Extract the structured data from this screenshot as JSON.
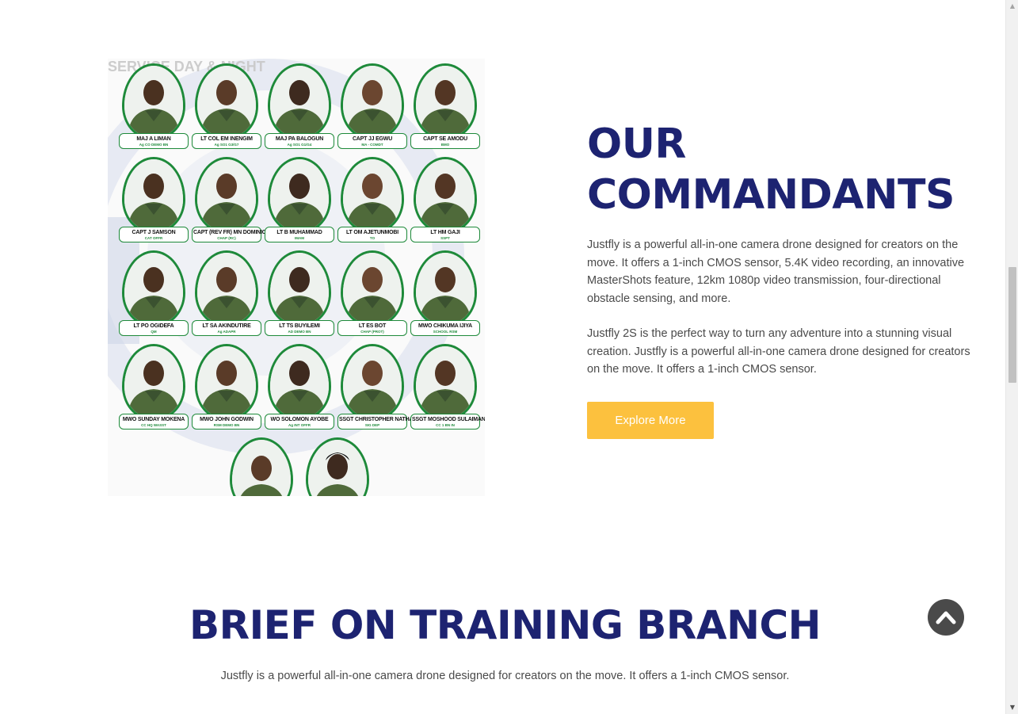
{
  "commandants": {
    "title_line1": "OUR",
    "title_line2": "COMMANDANTS",
    "para1": "Justfly is a powerful all-in-one camera drone designed for creators on the move. It offers a 1-inch CMOS sensor, 5.4K video recording, an innovative MasterShots feature, 12km 1080p video transmission, four-directional obstacle sensing, and more.",
    "para2": "Justfly 2S is the perfect way to turn any adventure into a stunning visual creation. Justfly is a powerful all-in-one camera drone designed for creators on the move. It offers a 1-inch CMOS sensor.",
    "button_label": "Explore More",
    "image": {
      "banner_text": "SERVICE DAY & NIGHT",
      "officers": [
        {
          "name": "MAJ A LIMAN",
          "role": "Ag CO DEMO BN"
        },
        {
          "name": "LT COL EM INENGIM",
          "role": "Ag SO1 G3/G7"
        },
        {
          "name": "MAJ PA BALOGUN",
          "role": "Ag SO1 G1/G4"
        },
        {
          "name": "CAPT JJ EGWU",
          "role": "MA - COMDT"
        },
        {
          "name": "CAPT SE AMODU",
          "role": "BMO"
        },
        {
          "name": "CAPT J SAMSON",
          "role": "CAT OFFR"
        },
        {
          "name": "CAPT (REV FR) MN DOMINIC",
          "role": "CHAP (RC)"
        },
        {
          "name": "LT B MUHAMMAD",
          "role": "IMAM"
        },
        {
          "name": "LT OM AJETUNMOBI",
          "role": "TO"
        },
        {
          "name": "LT HM GAJI",
          "role": "SSPT"
        },
        {
          "name": "LT PO OGIDEFA",
          "role": "QM"
        },
        {
          "name": "LT SA AKINDUTIRE",
          "role": "Ag ADAPR"
        },
        {
          "name": "LT TS BUYILEMI",
          "role": "AD DEMO BN"
        },
        {
          "name": "LT ES BOT",
          "role": "CHAP (PROT)"
        },
        {
          "name": "MWO CHIKUMA IJIYA",
          "role": "SCHOOL RSM"
        },
        {
          "name": "MWO SUNDAY MOKENA",
          "role": "CC HQ WASST"
        },
        {
          "name": "MWO JOHN GODWIN",
          "role": "RSM DEMO BN"
        },
        {
          "name": "WO SOLOMON AYOBE",
          "role": "Ag INT OFFR"
        },
        {
          "name": "SSGT CHRISTOPHER NATHANIEL",
          "role": "SIG DEP"
        },
        {
          "name": "SSGT MOSHOOD SULAIMAN",
          "role": "CC 1 BN IN"
        }
      ]
    }
  },
  "brief": {
    "title": "BRIEF ON TRAINING BRANCH",
    "para": "Justfly is a powerful all-in-one camera drone designed for creators on the move. It offers a 1-inch CMOS sensor."
  },
  "back_to_top": {
    "icon": "chevron-up-icon"
  },
  "colors": {
    "heading": "#1d2371",
    "button": "#fcc13e",
    "frame_green": "#1e8a3a",
    "back_to_top": "#4a4a4a"
  }
}
